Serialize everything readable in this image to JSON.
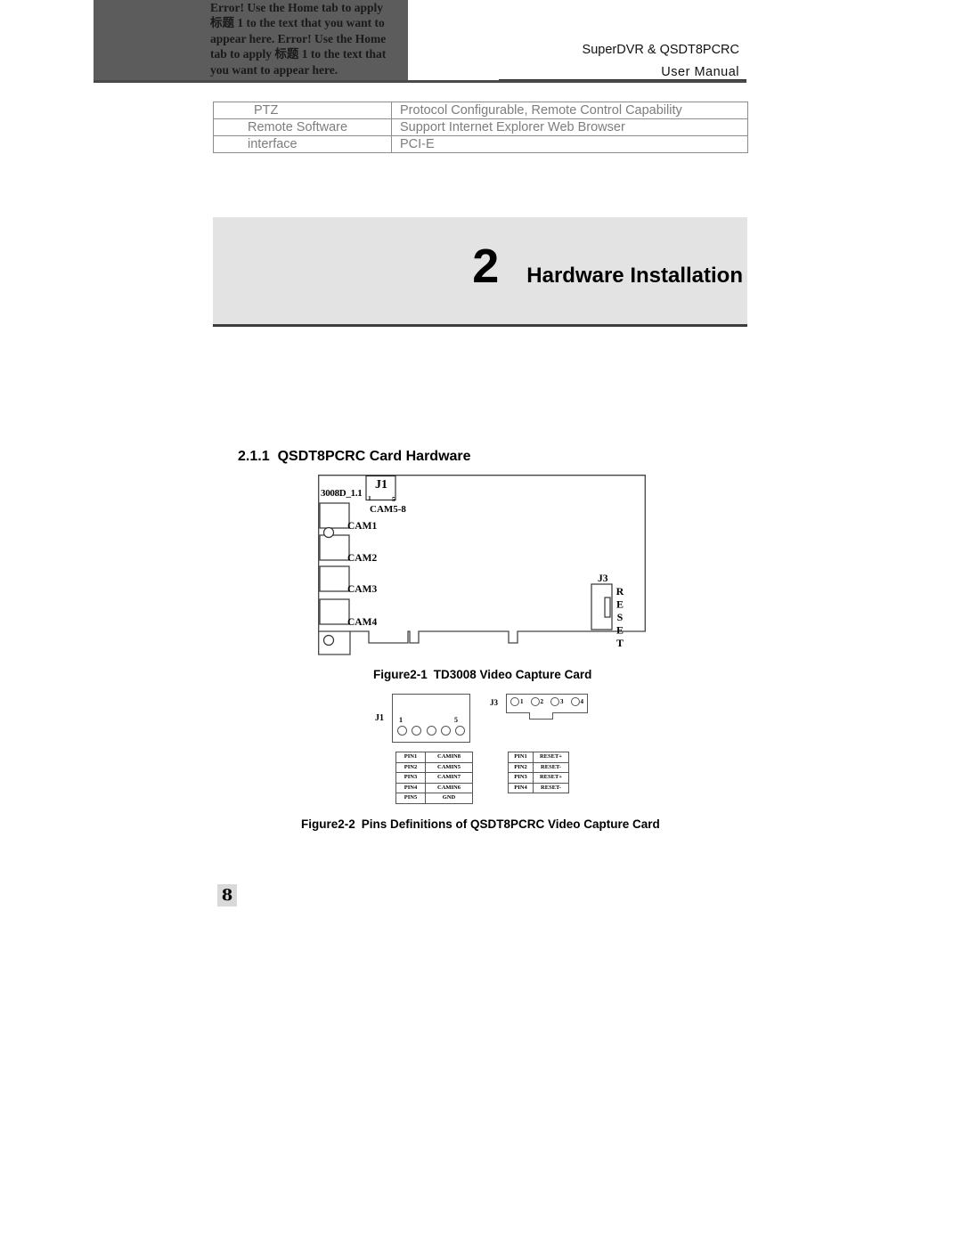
{
  "header": {
    "error_text_lines": [
      "Error! Use the Home tab to apply",
      "标题 1 to the text that you want to",
      "appear here. Error! Use the Home",
      "tab to apply 标题 1 to the text that",
      "you want to appear here."
    ],
    "product_line": "SuperDVR & QSDT8PCRC",
    "doc_type_line": "User  Manual"
  },
  "spec_table": {
    "rows": [
      {
        "key": "PTZ",
        "value": "Protocol Configurable, Remote Control Capability"
      },
      {
        "key": "Remote Software",
        "value": "Support Internet Explorer Web Browser"
      },
      {
        "key": "interface",
        "value": "PCI-E"
      }
    ]
  },
  "chapter": {
    "number": "2",
    "title": "Hardware Installation"
  },
  "section": {
    "number": "2.1.1",
    "title": "QSDT8PCRC Card Hardware"
  },
  "board_diagram": {
    "part_label": "3008D_1.1",
    "j1_label": "J1",
    "j1_pin_first": "1",
    "j1_pin_last": "5",
    "cam58_label": "CAM5-8",
    "cam_ports": [
      "CAM1",
      "CAM2",
      "CAM3",
      "CAM4"
    ],
    "j3_label": "J3",
    "reset_label": "RESET"
  },
  "figure1_caption": {
    "label": "Figure2-1",
    "text": "TD3008 Video Capture Card"
  },
  "pins_diagram": {
    "j1_label": "J1",
    "j1_pin_first": "1",
    "j1_pin_last": "5",
    "j1_pin_count": 5,
    "j3_label": "J3",
    "j3_pins": [
      "1",
      "2",
      "3",
      "4"
    ],
    "j1_table": [
      {
        "pin": "PIN1",
        "signal": "CAMIN8"
      },
      {
        "pin": "PIN2",
        "signal": "CAMIN5"
      },
      {
        "pin": "PIN3",
        "signal": "CAMIN7"
      },
      {
        "pin": "PIN4",
        "signal": "CAMIN6"
      },
      {
        "pin": "PIN5",
        "signal": "GND"
      }
    ],
    "j3_table": [
      {
        "pin": "PIN1",
        "signal": "RESET+"
      },
      {
        "pin": "PIN2",
        "signal": "RESET-"
      },
      {
        "pin": "PIN3",
        "signal": "RESET+"
      },
      {
        "pin": "PIN4",
        "signal": "RESET-"
      }
    ]
  },
  "figure2_caption": {
    "label": "Figure2-2",
    "text": "Pins Definitions of QSDT8PCRC Video Capture Card"
  },
  "page_number": "8",
  "colors": {
    "header_block": "#5c5c5c",
    "chapter_band": "#e3e3e3",
    "spec_text": "#7d7d7d",
    "rule": "#3d3d3d"
  }
}
